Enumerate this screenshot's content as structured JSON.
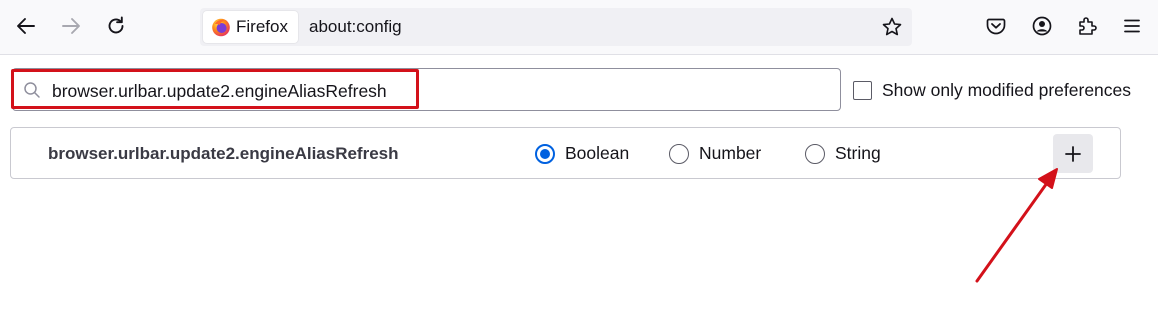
{
  "toolbar": {
    "back_icon": "back-arrow-icon",
    "forward_icon": "forward-arrow-icon",
    "reload_icon": "reload-icon",
    "identity_label": "Firefox",
    "url": "about:config",
    "right_icons": [
      "pocket-icon",
      "account-icon",
      "extensions-icon",
      "menu-icon"
    ]
  },
  "search": {
    "value": "browser.urlbar.update2.engineAliasRefresh"
  },
  "modified_only": {
    "label": "Show only modified preferences",
    "checked": false
  },
  "new_pref": {
    "name": "browser.urlbar.update2.engineAliasRefresh",
    "types": [
      {
        "label": "Boolean",
        "selected": true
      },
      {
        "label": "Number",
        "selected": false
      },
      {
        "label": "String",
        "selected": false
      }
    ],
    "add_label": "+"
  },
  "colors": {
    "accent": "#0061e0",
    "highlight": "#d3111a"
  }
}
